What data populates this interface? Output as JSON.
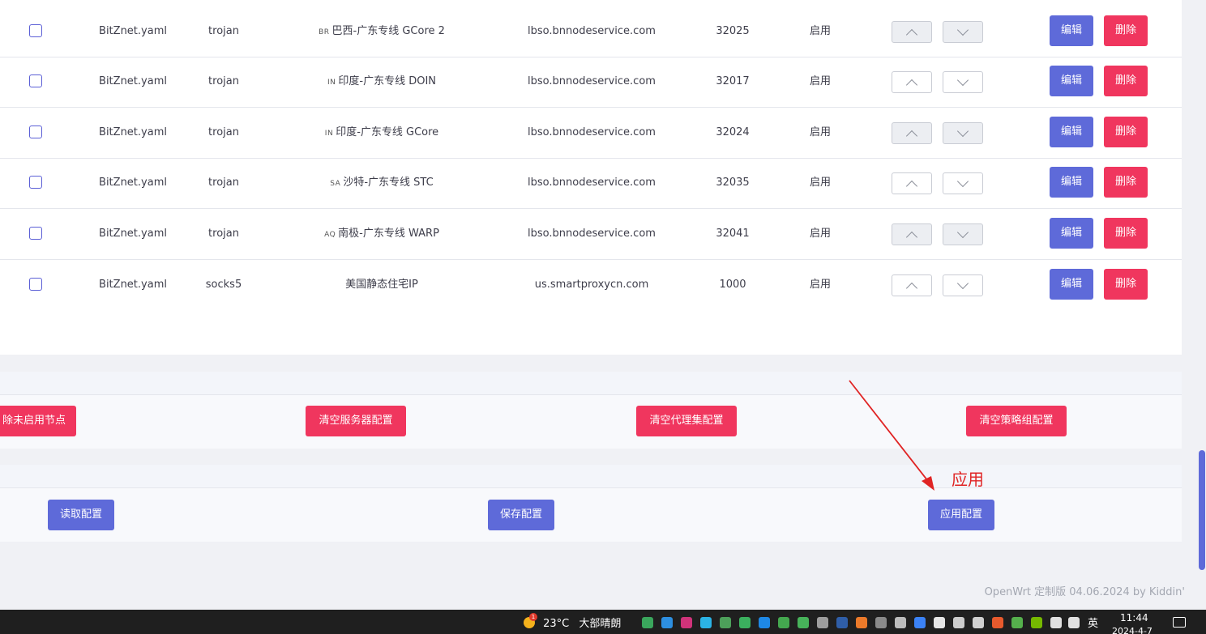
{
  "table": {
    "rows": [
      {
        "config": "BitZnet.yaml",
        "type": "trojan",
        "flag": "BR",
        "name": "巴西-广东专线 GCore 2",
        "server": "lbso.bnnodeservice.com",
        "port": "32025",
        "status": "启用",
        "up_disabled": true,
        "down_disabled": true
      },
      {
        "config": "BitZnet.yaml",
        "type": "trojan",
        "flag": "IN",
        "name": "印度-广东专线 DOIN",
        "server": "lbso.bnnodeservice.com",
        "port": "32017",
        "status": "启用",
        "up_disabled": false,
        "down_disabled": false
      },
      {
        "config": "BitZnet.yaml",
        "type": "trojan",
        "flag": "IN",
        "name": "印度-广东专线 GCore",
        "server": "lbso.bnnodeservice.com",
        "port": "32024",
        "status": "启用",
        "up_disabled": true,
        "down_disabled": true
      },
      {
        "config": "BitZnet.yaml",
        "type": "trojan",
        "flag": "SA",
        "name": "沙特-广东专线 STC",
        "server": "lbso.bnnodeservice.com",
        "port": "32035",
        "status": "启用",
        "up_disabled": false,
        "down_disabled": false
      },
      {
        "config": "BitZnet.yaml",
        "type": "trojan",
        "flag": "AQ",
        "name": "南极-广东专线 WARP",
        "server": "lbso.bnnodeservice.com",
        "port": "32041",
        "status": "启用",
        "up_disabled": true,
        "down_disabled": true
      },
      {
        "config": "BitZnet.yaml",
        "type": "socks5",
        "flag": "",
        "name": "美国静态住宅IP",
        "server": "us.smartproxycn.com",
        "port": "1000",
        "status": "启用",
        "up_disabled": false,
        "down_disabled": false
      }
    ],
    "edit_label": "编辑",
    "delete_label": "删除"
  },
  "clear_panel": {
    "delete_disabled_label": "除未启用节点",
    "clear_servers_label": "清空服务器配置",
    "clear_proxy_providers_label": "清空代理集配置",
    "clear_groups_label": "清空策略组配置"
  },
  "config_panel": {
    "read_label": "读取配置",
    "save_label": "保存配置",
    "apply_label": "应用配置"
  },
  "annotation": {
    "text": "应用"
  },
  "footer": {
    "text": "OpenWrt 定制版 04.06.2024 by Kiddin'"
  },
  "taskbar": {
    "weather_badge": "1",
    "temperature": "23°C",
    "weather_text": "大部晴朗",
    "input_lang": "英",
    "time": "11:44",
    "date": "2024-4-7"
  },
  "colors": {
    "primary": "#5e6ad9",
    "danger": "#f0365e",
    "annotation": "#e02424"
  }
}
